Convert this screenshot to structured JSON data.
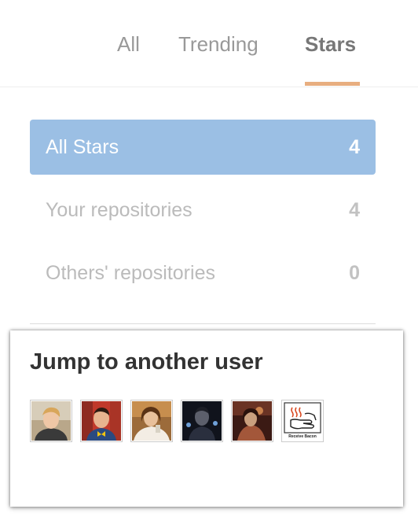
{
  "tabs": [
    {
      "label": "All",
      "active": false
    },
    {
      "label": "Trending",
      "active": false
    },
    {
      "label": "Stars",
      "active": true
    }
  ],
  "filters": [
    {
      "label": "All Stars",
      "count": "4",
      "selected": true
    },
    {
      "label": "Your repositories",
      "count": "4",
      "selected": false
    },
    {
      "label": "Others' repositories",
      "count": "0",
      "selected": false
    }
  ],
  "jump": {
    "title": "Jump to another user",
    "avatars": [
      {
        "icon": "user-avatar-photo"
      },
      {
        "icon": "user-avatar-photo"
      },
      {
        "icon": "user-avatar-photo"
      },
      {
        "icon": "user-avatar-photo"
      },
      {
        "icon": "user-avatar-photo"
      },
      {
        "icon": "receive-bacon-sign",
        "caption": "Receive Bacon"
      }
    ]
  },
  "colors": {
    "accent_underline": "#e8ae80",
    "selected_bg": "#9bbfe4",
    "muted_text": "#bbbbbb"
  }
}
